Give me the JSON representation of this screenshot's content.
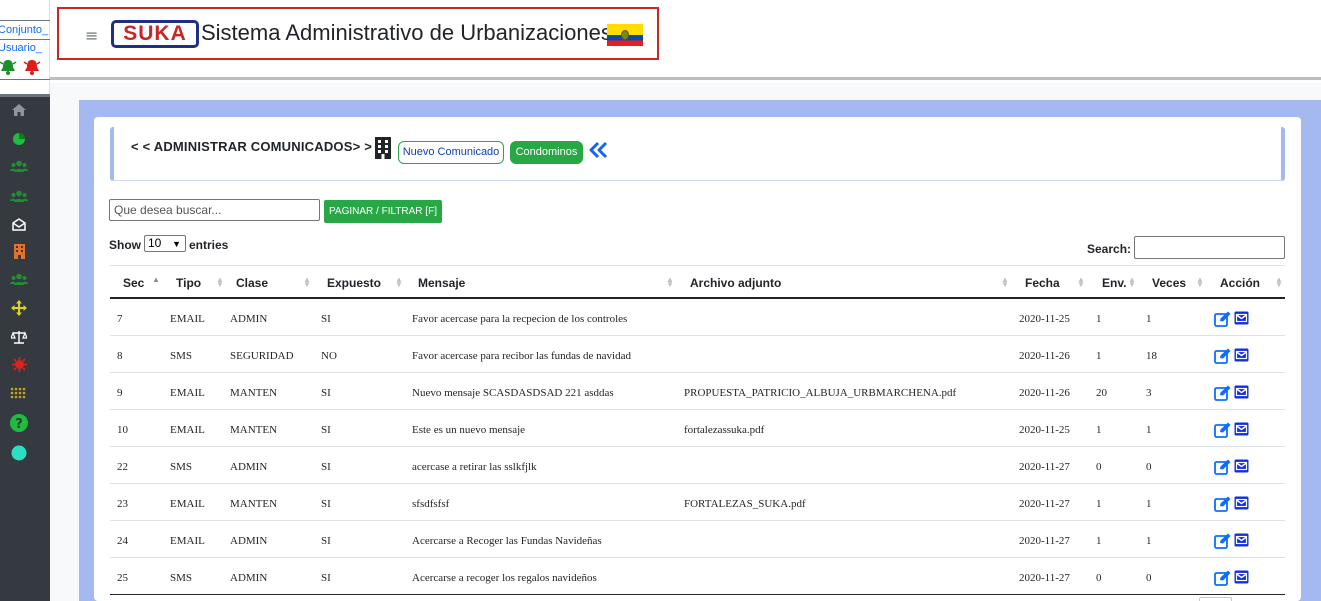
{
  "sidebar": {
    "link_conjunto": "Conjunto_",
    "link_usuario": "Usuario_",
    "icons": [
      "home-icon",
      "chart-pie-icon",
      "users-icon",
      "users-icon",
      "envelope-open-icon",
      "building-icon",
      "users-icon",
      "arrows-move-icon",
      "balance-scale-icon",
      "virus-icon",
      "dots-grid-icon",
      "question-icon",
      "circle-icon"
    ]
  },
  "header": {
    "logo_text": "SUKA",
    "title": "Sistema Administrativo de Urbanizaciones"
  },
  "page": {
    "title": "< < ADMINISTRAR COMUNICADOS> >",
    "btn_new": "Nuevo Comunicado",
    "btn_condominos": "Condominos"
  },
  "filter": {
    "placeholder": "Que desea buscar...",
    "button": "PAGINAR / FILTRAR [F]"
  },
  "datatable": {
    "show": "Show",
    "page_length": "10",
    "entries": "entries",
    "search_label": "Search:"
  },
  "table": {
    "headers": {
      "sec": "Sec",
      "tipo": "Tipo",
      "clase": "Clase",
      "expuesto": "Expuesto",
      "mensaje": "Mensaje",
      "archivo": "Archivo adjunto",
      "fecha": "Fecha",
      "env": "Env.",
      "veces": "Veces",
      "accion": "Acción"
    },
    "rows": [
      {
        "sec": "7",
        "tipo": "EMAIL",
        "clase": "ADMIN",
        "expuesto": "SI",
        "mensaje": "Favor acercase para la recpecion de los controles",
        "archivo": "",
        "fecha": "2020-11-25",
        "env": "1",
        "veces": "1"
      },
      {
        "sec": "8",
        "tipo": "SMS",
        "clase": "SEGURIDAD",
        "expuesto": "NO",
        "mensaje": "Favor acercase para recibor las fundas de navidad",
        "archivo": "",
        "fecha": "2020-11-26",
        "env": "1",
        "veces": "18"
      },
      {
        "sec": "9",
        "tipo": "EMAIL",
        "clase": "MANTEN",
        "expuesto": "SI",
        "mensaje": "Nuevo mensaje SCASDASDSAD 221 asddas",
        "archivo": "PROPUESTA_PATRICIO_ALBUJA_URBMARCHENA.pdf",
        "fecha": "2020-11-26",
        "env": "20",
        "veces": "3"
      },
      {
        "sec": "10",
        "tipo": "EMAIL",
        "clase": "MANTEN",
        "expuesto": "SI",
        "mensaje": "Este es un nuevo mensaje",
        "archivo": "fortalezassuka.pdf",
        "fecha": "2020-11-25",
        "env": "1",
        "veces": "1"
      },
      {
        "sec": "22",
        "tipo": "SMS",
        "clase": "ADMIN",
        "expuesto": "SI",
        "mensaje": "acercase a retirar las sslkfjlk",
        "archivo": "",
        "fecha": "2020-11-27",
        "env": "0",
        "veces": "0"
      },
      {
        "sec": "23",
        "tipo": "EMAIL",
        "clase": "MANTEN",
        "expuesto": "SI",
        "mensaje": "sfsdfsfsf",
        "archivo": "FORTALEZAS_SUKA.pdf",
        "fecha": "2020-11-27",
        "env": "1",
        "veces": "1"
      },
      {
        "sec": "24",
        "tipo": "EMAIL",
        "clase": "ADMIN",
        "expuesto": "SI",
        "mensaje": "Acercarse a Recoger las Fundas Navideñas",
        "archivo": "",
        "fecha": "2020-11-27",
        "env": "1",
        "veces": "1"
      },
      {
        "sec": "25",
        "tipo": "SMS",
        "clase": "ADMIN",
        "expuesto": "SI",
        "mensaje": "Acercarse a recoger los regalos navideños",
        "archivo": "",
        "fecha": "2020-11-27",
        "env": "0",
        "veces": "0"
      }
    ]
  },
  "colors": {
    "accent_blue": "#0d6efd",
    "success_green": "#28a745",
    "frame_blue": "#a4b9ef",
    "brand_red": "#c62828",
    "sidebar_dark": "#343a40"
  }
}
